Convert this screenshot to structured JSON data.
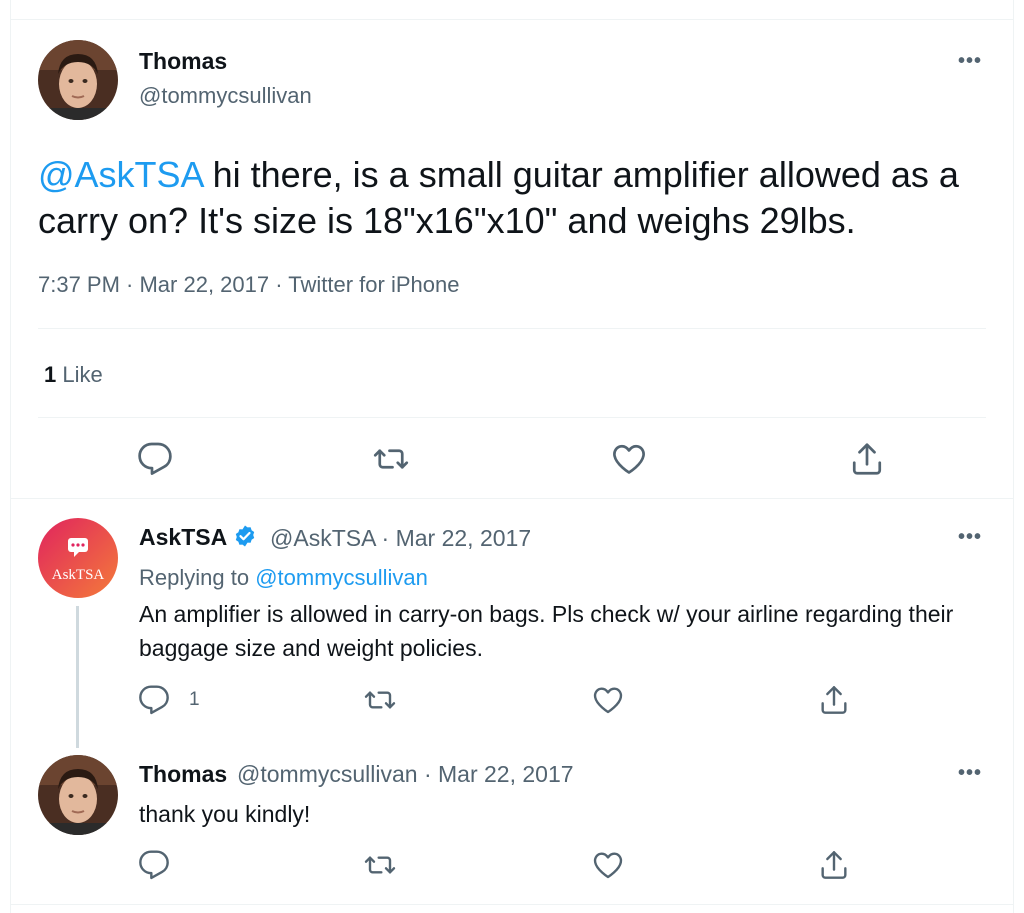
{
  "main_tweet": {
    "author_name": "Thomas",
    "author_handle": "@tommycsullivan",
    "mention": "@AskTSA",
    "text": " hi there, is a small guitar amplifier allowed as a carry on? It's size is 18\"x16\"x10\" and weighs 29lbs.",
    "meta": "7:37 PM · Mar 22, 2017 · Twitter for iPhone",
    "like_count": "1",
    "like_label": "Like",
    "more_label": "•••"
  },
  "reply_1": {
    "author_name": "AskTSA",
    "author_handle_date": "@AskTSA · Mar 22, 2017",
    "avatar_text": "AskTSA",
    "replying_prefix": "Replying to ",
    "replying_handle": "@tommycsullivan",
    "text": "An amplifier is allowed in carry-on bags. Pls check w/ your airline regarding their baggage size and weight policies.",
    "reply_count": "1",
    "more_label": "•••"
  },
  "reply_2": {
    "author_name": "Thomas",
    "author_handle_date": "@tommycsullivan · Mar 22, 2017",
    "text": "thank you kindly!",
    "more_label": "•••"
  },
  "colors": {
    "accent": "#1d9bf0",
    "secondary_text": "#536471",
    "divider": "#eff3f4",
    "asktsa_gradient_start": "#e0245e",
    "asktsa_gradient_end": "#f47b3a"
  },
  "icons": [
    "reply-icon",
    "retweet-icon",
    "like-icon",
    "share-icon",
    "more-icon",
    "verified-badge-icon"
  ]
}
